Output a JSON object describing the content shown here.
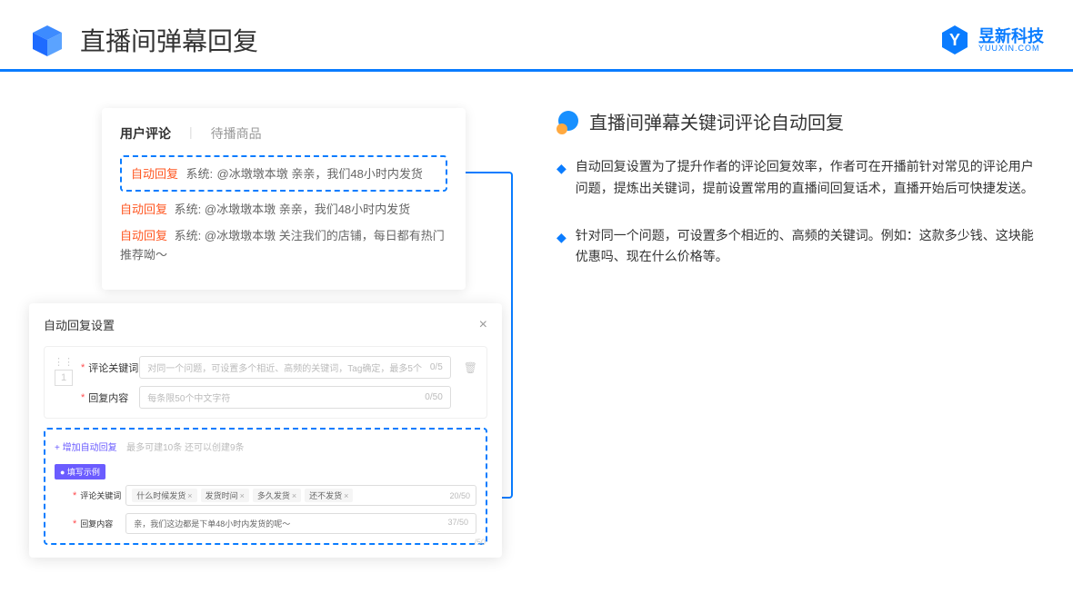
{
  "header": {
    "title": "直播间弹幕回复",
    "brand_name": "昱新科技",
    "brand_sub": "YUUXIN.COM"
  },
  "right": {
    "subtitle": "直播间弹幕关键词评论自动回复",
    "points": [
      "自动回复设置为了提升作者的评论回复效率，作者可在开播前针对常见的评论用户问题，提炼出关键词，提前设置常用的直播间回复话术，直播开始后可快捷发送。",
      "针对同一个问题，可设置多个相近的、高频的关键词。例如：这款多少钱、这块能优惠吗、现在什么价格等。"
    ]
  },
  "card1": {
    "tab_active": "用户评论",
    "tab_inactive": "待播商品",
    "comments": {
      "label": "自动回复",
      "system": "系统:",
      "c1": "@冰墩墩本墩 亲亲，我们48小时内发货",
      "c2": "@冰墩墩本墩 亲亲，我们48小时内发货",
      "c3": "@冰墩墩本墩 关注我们的店铺，每日都有热门推荐呦～"
    }
  },
  "card2": {
    "title": "自动回复设置",
    "num": "1",
    "field1_label": "评论关键词",
    "field1_placeholder": "对同一个问题，可设置多个相近、高频的关键词，Tag确定，最多5个",
    "field1_counter": "0/5",
    "field2_label": "回复内容",
    "field2_placeholder": "每条限50个中文字符",
    "field2_counter": "0/50",
    "add_link": "+ 增加自动回复",
    "add_hint": "最多可建10条 还可以创建9条",
    "example_badge": "● 填写示例",
    "ex_label1": "评论关键词",
    "ex_tags": [
      "什么时候发货",
      "发货时间",
      "多久发货",
      "还不发货"
    ],
    "ex_counter1": "20/50",
    "ex_label2": "回复内容",
    "ex_text": "亲，我们这边都是下单48小时内发货的呢～",
    "ex_counter2": "37/50",
    "bottom_counter": "/50"
  }
}
